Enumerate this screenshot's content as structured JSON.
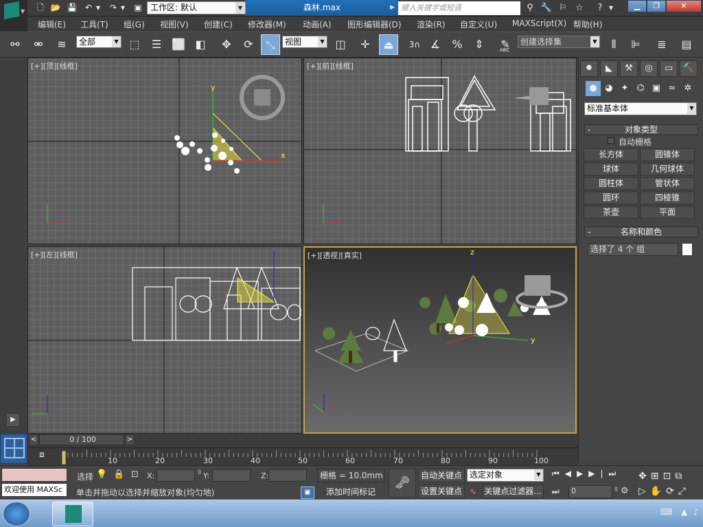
{
  "titlebar": {
    "workspace_label": "工作区: 默认",
    "document_title": "森林.max",
    "search_placeholder": "键入关键字或短语"
  },
  "menu": [
    "编辑(E)",
    "工具(T)",
    "组(G)",
    "视图(V)",
    "创建(C)",
    "修改器(M)",
    "动画(A)",
    "图形编辑器(D)",
    "渲染(R)",
    "自定义(U)",
    "MAXScript(X)",
    "帮助(H)"
  ],
  "toolbar": {
    "selection_filter": "全部",
    "ref_coord": "视图",
    "named_selection": "创建选择集",
    "snap_label": "3",
    "abc_label": "ABC"
  },
  "viewports": {
    "top": "[+][顶][线框]",
    "front": "[+][前][线框]",
    "left": "[+][左][线框]",
    "perspective": "[+][透视][真实]"
  },
  "axis_labels": {
    "x": "x",
    "y": "y",
    "z": "z"
  },
  "command_panel": {
    "category": "标准基本体",
    "rollout_object_type": "对象类型",
    "autogrid_label": "自动栅格",
    "object_buttons": [
      "长方体",
      "圆锥体",
      "球体",
      "几何球体",
      "圆柱体",
      "管状体",
      "圆环",
      "四棱锥",
      "茶壶",
      "平面"
    ],
    "rollout_name_color": "名称和颜色",
    "name_field": "选择了 4 个 组",
    "collapse_symbol": "-"
  },
  "timeline": {
    "frame_display": "0 / 100",
    "ticks": [
      "10",
      "20",
      "30",
      "40",
      "50",
      "60",
      "70",
      "80",
      "90",
      "100"
    ],
    "start_label": "0"
  },
  "status": {
    "maxscript_listener": "欢迎使用 MAXSc",
    "select_label": "选择",
    "x_label": "X:",
    "y_label": "Y:",
    "z_label": "Z:",
    "grid": "栅格 = 10.0mm",
    "prompt": "单击并拖动以选择并缩放对象(均匀地)",
    "add_time_tag": "添加时间标记",
    "auto_key": "自动关键点",
    "set_key": "设置关键点",
    "key_filter_value": "选定对象",
    "key_filters": "关键点过滤器...",
    "current_frame": "0"
  },
  "colors": {
    "viewport_bg": "#5e5e5e",
    "grid_line": "#6e6e6e",
    "selection_yellow": "#ffee44",
    "title_accent": "#1a5e9e",
    "active_viewport_border": "#c8a040"
  }
}
